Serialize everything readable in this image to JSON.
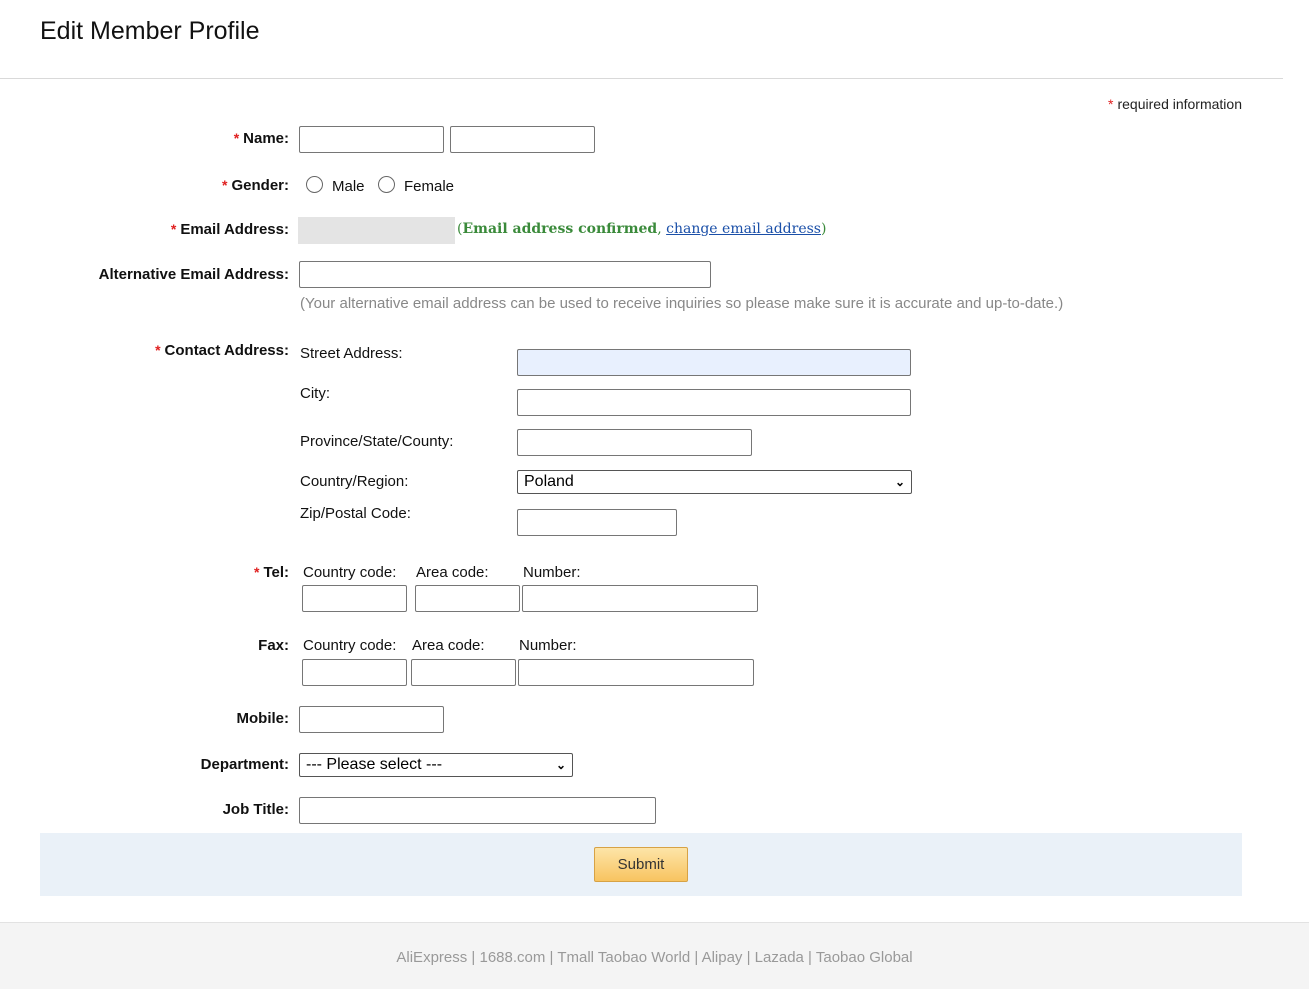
{
  "page_title": "Edit Member Profile",
  "required_note": "required information",
  "required_marker": "*",
  "form": {
    "name_label": "Name:",
    "gender_label": "Gender:",
    "gender_options": [
      "Male",
      "Female"
    ],
    "email_label": "Email Address:",
    "email_confirmed": "Email address confirmed",
    "email_change_link": "change email address",
    "alt_email_label": "Alternative Email Address:",
    "alt_email_hint": "(Your alternative email address can be used to receive inquiries so please make sure it is accurate and up-to-date.)",
    "contact_label": "Contact Address:",
    "street_label": "Street Address:",
    "city_label": "City:",
    "province_label": "Province/State/County:",
    "country_label": "Country/Region:",
    "country_value": "Poland",
    "zip_label": "Zip/Postal Code:",
    "tel_label": "Tel:",
    "fax_label": "Fax:",
    "country_code_label": "Country code:",
    "area_code_label": "Area code:",
    "number_label": "Number:",
    "mobile_label": "Mobile:",
    "department_label": "Department:",
    "department_value": "--- Please select ---",
    "job_title_label": "Job Title:"
  },
  "submit_label": "Submit",
  "footer_links": [
    "AliExpress",
    "1688.com",
    "Tmall Taobao World",
    "Alipay",
    "Lazada",
    "Taobao Global"
  ],
  "colors": {
    "required_star": "#e02020",
    "confirmed_green": "#3a8a3a",
    "link_blue": "#1a4fa8",
    "submit_bar_bg": "#eaf1f8"
  }
}
